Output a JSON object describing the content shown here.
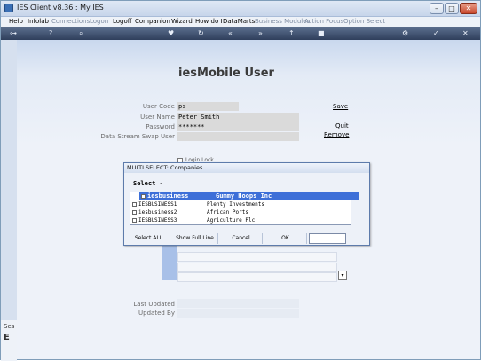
{
  "window": {
    "title": "IES Client v8.36 : My IES",
    "minimize": "–",
    "maximize": "□",
    "close": "✕"
  },
  "menu": [
    {
      "label": "Help",
      "enabled": true
    },
    {
      "label": "Infolab",
      "enabled": true
    },
    {
      "label": "Connections",
      "enabled": false
    },
    {
      "label": "Logon",
      "enabled": false
    },
    {
      "label": "Logoff",
      "enabled": true
    },
    {
      "label": "Companion",
      "enabled": true
    },
    {
      "label": "Wizard",
      "enabled": true
    },
    {
      "label": "How do I",
      "enabled": true
    },
    {
      "label": "DataMarts",
      "enabled": true
    },
    {
      "label": "Business Modules",
      "enabled": false
    },
    {
      "label": "Action Focus",
      "enabled": false
    },
    {
      "label": "Option Select",
      "enabled": false
    }
  ],
  "toolbar": {
    "key_icon": "key-icon",
    "help_icon": "help-icon",
    "search_icon": "search-icon",
    "heart_icon": "heart-icon",
    "refresh_icon": "refresh-icon",
    "back_icon": "rewind-icon",
    "forward_icon": "fast-forward-icon",
    "up_icon": "up-icon",
    "stop_icon": "stop-icon",
    "settings_icon": "gear-icon",
    "check_icon": "check-icon",
    "close_icon": "close-icon"
  },
  "form": {
    "heading": "iesMobile User",
    "user_code_label": "User Code",
    "user_code_value": "ps",
    "user_name_label": "User Name",
    "user_name_value": "Peter Smith",
    "password_label": "Password",
    "password_value": "*******",
    "swap_user_label": "Data Stream Swap User",
    "swap_user_value": "",
    "save_link": "Save",
    "quit_link": "Quit",
    "remove_link": "Remove",
    "login_lock_label": "Login Lock",
    "last_updated_label": "Last Updated",
    "last_updated_value": "",
    "updated_by_label": "Updated By",
    "updated_by_value": "",
    "scroll_glyph": "▾"
  },
  "dialog": {
    "title": "MULTI SELECT: Companies",
    "select_label": "Select -",
    "items": [
      {
        "code": "iesbusiness",
        "name": "Gummy Hoops Inc",
        "selected": true
      },
      {
        "code": "IESBUSINESS1",
        "name": "Plenty Investments",
        "selected": false
      },
      {
        "code": "iesbusiness2",
        "name": "African Ports",
        "selected": false
      },
      {
        "code": "IESBUSINESS3",
        "name": "Agriculture Plc",
        "selected": false
      }
    ],
    "buttons": {
      "select_all": "Select ALL",
      "show_full_line": "Show Full Line",
      "cancel": "Cancel",
      "ok": "OK"
    },
    "search_value": ""
  },
  "statusbar": {
    "left_text": "Ses",
    "left_glyph": "E"
  },
  "colors": {
    "toolbar_bg": "#2f3f5c",
    "selection": "#3d6fd8",
    "content_bg": "#eef2f9"
  }
}
